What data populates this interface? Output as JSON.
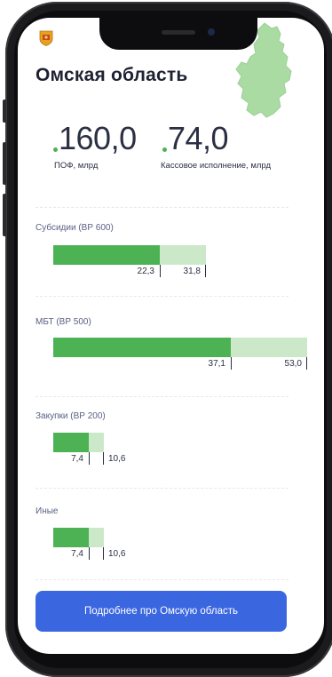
{
  "region": {
    "title": "Омская область"
  },
  "kpis": [
    {
      "value": "160,0",
      "label": "ПОФ, млрд"
    },
    {
      "value": "74,0",
      "label": "Кассовое исполнение, млрд"
    }
  ],
  "categories": [
    {
      "label": "Субсидии (ВР 600)",
      "executed": 22.3,
      "executed_label": "22,3",
      "planned": 31.8,
      "planned_label": "31,8"
    },
    {
      "label": "МБТ (ВР 500)",
      "executed": 37.1,
      "executed_label": "37,1",
      "planned": 53.0,
      "planned_label": "53,0"
    },
    {
      "label": "Закупки (ВР 200)",
      "executed": 7.4,
      "executed_label": "7,4",
      "planned": 10.6,
      "planned_label": "10,6"
    },
    {
      "label": "Иные",
      "executed": 7.4,
      "executed_label": "7,4",
      "planned": 10.6,
      "planned_label": "10,6"
    }
  ],
  "cta": {
    "label": "Подробнее про Омскую область"
  },
  "colors": {
    "executed": "#4cb253",
    "planned": "#cbe9c8",
    "button": "#3a66e0",
    "map": "#a9dba3"
  }
}
